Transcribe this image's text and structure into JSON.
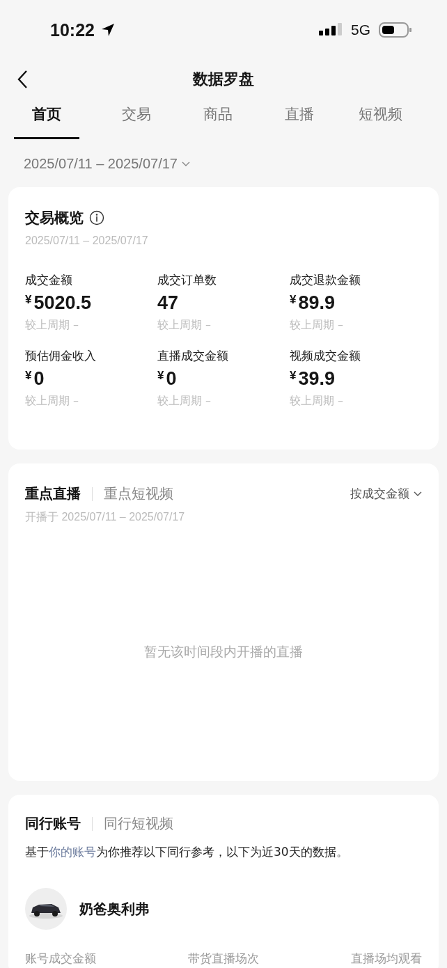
{
  "status_bar": {
    "time": "10:22",
    "network": "5G"
  },
  "nav": {
    "title": "数据罗盘"
  },
  "tabs": [
    {
      "label": "首页",
      "selected": true
    },
    {
      "label": "交易",
      "selected": false
    },
    {
      "label": "商品",
      "selected": false
    },
    {
      "label": "直播",
      "selected": false
    },
    {
      "label": "短视频",
      "selected": false
    }
  ],
  "date_range": "2025/07/11 – 2025/07/17",
  "overview": {
    "title": "交易概览",
    "date": "2025/07/11 – 2025/07/17",
    "metrics": [
      {
        "label": "成交金额",
        "currency": "¥",
        "value": "5020.5",
        "compare": "较上周期 –"
      },
      {
        "label": "成交订单数",
        "value": "47",
        "compare": "较上周期 –"
      },
      {
        "label": "成交退款金额",
        "currency": "¥",
        "value": "89.9",
        "compare": "较上周期 –"
      },
      {
        "label": "预估佣金收入",
        "currency": "¥",
        "value": "0",
        "compare": "较上周期 –"
      },
      {
        "label": "直播成交金额",
        "currency": "¥",
        "value": "0",
        "compare": "较上周期 –"
      },
      {
        "label": "视频成交金额",
        "currency": "¥",
        "value": "39.9",
        "compare": "较上周期 –"
      }
    ]
  },
  "featured": {
    "tabs": [
      {
        "label": "重点直播",
        "selected": true
      },
      {
        "label": "重点短视频",
        "selected": false
      }
    ],
    "sort": "按成交金额",
    "subtitle": "开播于 2025/07/11 – 2025/07/17",
    "empty": "暂无该时间段内开播的直播"
  },
  "peers": {
    "tabs": [
      {
        "label": "同行账号",
        "selected": true
      },
      {
        "label": "同行短视频",
        "selected": false
      }
    ],
    "note": {
      "before": "基于",
      "link": "你的账号",
      "after": "为你推荐以下同行参考，以下为近30天的数据。"
    },
    "account": {
      "name": "奶爸奥利弗"
    },
    "columns": [
      "账号成交金额",
      "带货直播场次",
      "直播场均观看"
    ]
  }
}
